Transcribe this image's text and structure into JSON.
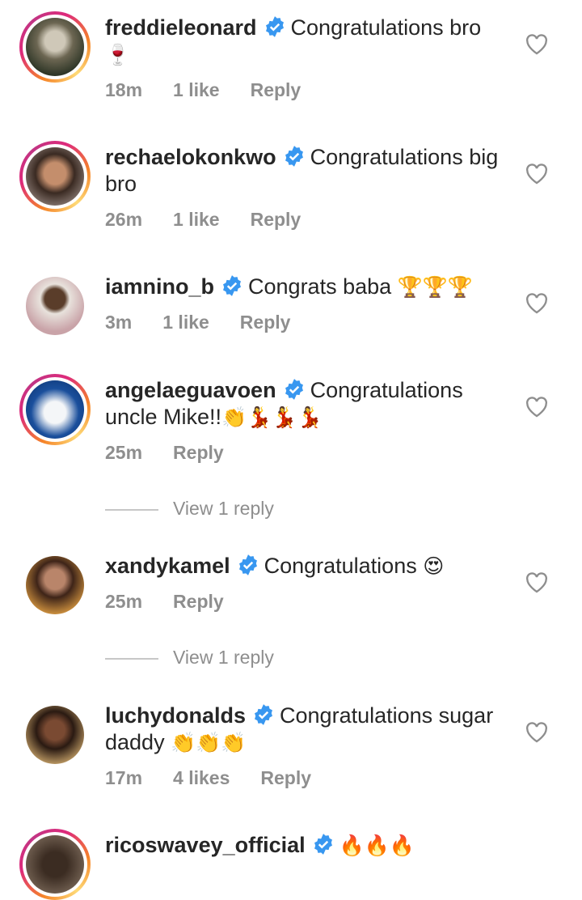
{
  "comments": [
    {
      "username": "freddieleonard",
      "text": "Congratulations bro",
      "emoji_line2": "🍷",
      "time": "18m",
      "likes": "1 like",
      "reply": "Reply"
    },
    {
      "username": "rechaelokonkwo",
      "text": "Congratulations big",
      "line2": "bro",
      "time": "26m",
      "likes": "1 like",
      "reply": "Reply"
    },
    {
      "username": "iamnino_b",
      "text": "Congrats baba",
      "emoji": "🏆🏆🏆",
      "time": "3m",
      "likes": "1 like",
      "reply": "Reply"
    },
    {
      "username": "angelaeguavoen",
      "text": "Congratulations",
      "line2": "uncle Mike!!",
      "emoji": "👏💃💃💃",
      "time": "25m",
      "reply": "Reply",
      "view_replies": "View 1 reply"
    },
    {
      "username": "xandykamel",
      "text": "Congratulations",
      "emoji": "😍",
      "time": "25m",
      "reply": "Reply",
      "view_replies": "View 1 reply"
    },
    {
      "username": "luchydonalds",
      "text": "Congratulations sugar",
      "line2": "daddy",
      "emoji": "👏👏👏",
      "time": "17m",
      "likes": "4 likes",
      "reply": "Reply"
    },
    {
      "username": "ricoswavey_official",
      "emoji": "🔥🔥🔥"
    }
  ],
  "colors": {
    "verified": "#3897f0",
    "meta": "#8e8e8e",
    "divider": "#c7c7c7"
  },
  "icons": {
    "verified": "verified-badge-icon",
    "like": "heart-outline-icon"
  }
}
